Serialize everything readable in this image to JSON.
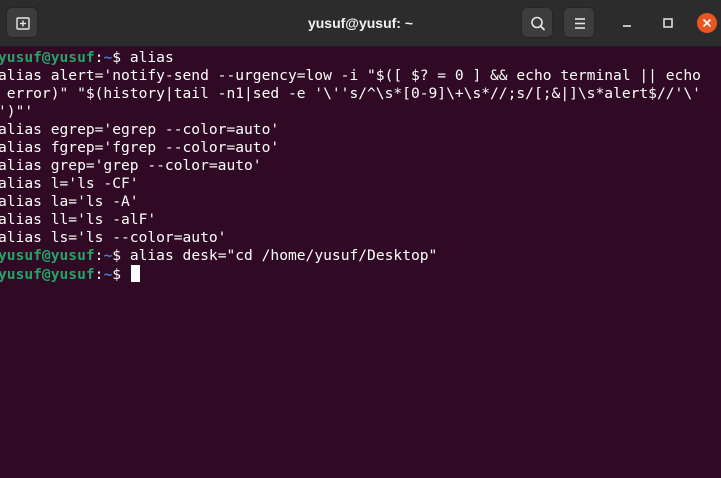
{
  "window": {
    "title": "yusuf@yusuf: ~"
  },
  "icons": {
    "new_tab": "new-tab-icon",
    "search": "search-icon",
    "menu": "hamburger-menu-icon",
    "minimize": "minimize-icon",
    "maximize": "maximize-icon",
    "close": "close-icon"
  },
  "colors": {
    "terminal_bg": "#300a24",
    "titlebar_bg": "#2c2c2c",
    "prompt_user": "#26a269",
    "prompt_path": "#3f7fd6",
    "close_button": "#e95420",
    "text": "#ffffff"
  },
  "terminal": {
    "prompt1": {
      "user": "yusuf@yusuf",
      "sep": ":",
      "path": "~",
      "symbol": "$ ",
      "command": "alias"
    },
    "output": [
      "alias alert='notify-send --urgency=low -i \"$([ $? = 0 ] && echo terminal || echo",
      " error)\" \"$(history|tail -n1|sed -e '\\''s/^\\s*[0-9]\\+\\s*//;s/[;&|]\\s*alert$//'\\'",
      "')\"'",
      "alias egrep='egrep --color=auto'",
      "alias fgrep='fgrep --color=auto'",
      "alias grep='grep --color=auto'",
      "alias l='ls -CF'",
      "alias la='ls -A'",
      "alias ll='ls -alF'",
      "alias ls='ls --color=auto'"
    ],
    "prompt2": {
      "user": "yusuf@yusuf",
      "sep": ":",
      "path": "~",
      "symbol": "$ ",
      "command": "alias desk=\"cd /home/yusuf/Desktop\""
    },
    "prompt3": {
      "user": "yusuf@yusuf",
      "sep": ":",
      "path": "~",
      "symbol": "$ ",
      "command": ""
    }
  }
}
